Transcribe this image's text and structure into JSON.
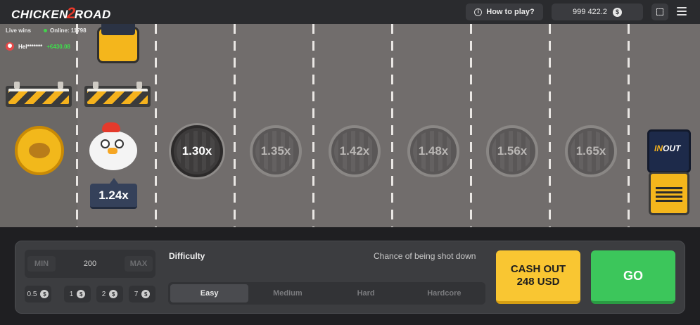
{
  "header": {
    "logo_text_a": "CHICKEN",
    "logo_text_b": "2",
    "logo_text_c": "ROAD",
    "how_to_play": "How to play?",
    "balance": "999 422.2",
    "currency_symbol": "$"
  },
  "stats": {
    "live_wins": "Live wins",
    "online": "Online: 11798",
    "winner_name": "Hel*******",
    "winner_amount": "+€430.08"
  },
  "road": {
    "current_multiplier": "1.24x",
    "multipliers": [
      "1.30x",
      "1.35x",
      "1.42x",
      "1.48x",
      "1.56x",
      "1.65x"
    ],
    "truck_brand_a": "IN",
    "truck_brand_b": "OUT"
  },
  "controls": {
    "min_label": "MIN",
    "bet_value": "200",
    "max_label": "MAX",
    "chips": [
      "0.5",
      "1",
      "2",
      "7"
    ],
    "difficulty_label": "Difficulty",
    "chance_label": "Chance of being shot down",
    "difficulties": [
      "Easy",
      "Medium",
      "Hard",
      "Hardcore"
    ],
    "selected_difficulty": "Easy",
    "cashout_line1": "CASH OUT",
    "cashout_line2": "248 USD",
    "go_label": "GO"
  },
  "colors": {
    "cashout": "#f9c632",
    "go": "#3cc65b",
    "road": "#716d6c",
    "win_green": "#3ee04b"
  }
}
